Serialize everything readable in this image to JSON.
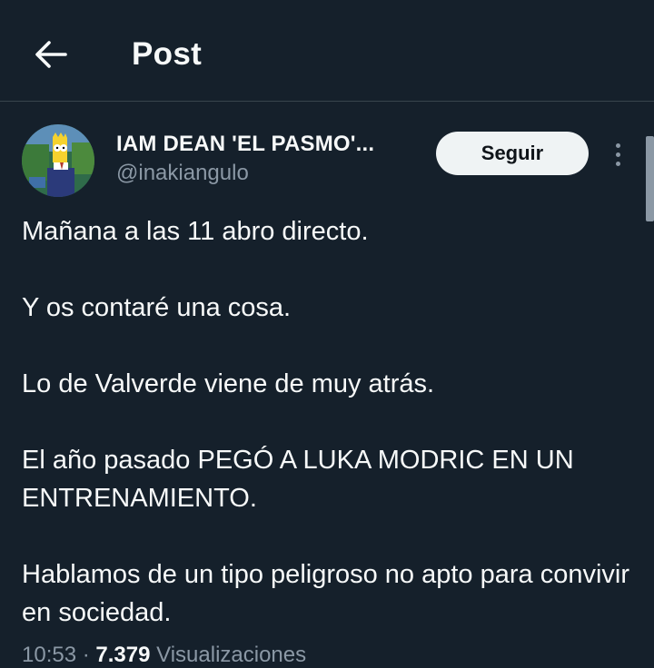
{
  "header": {
    "title": "Post"
  },
  "author": {
    "display_name": "IAM DEAN 'EL PASMO'...",
    "handle": "@inakiangulo"
  },
  "follow_button": {
    "label": "Seguir"
  },
  "tweet": {
    "paragraphs": [
      "Mañana a las 11 abro directo.",
      "Y os contaré una cosa.",
      "Lo de Valverde viene de muy atrás.",
      "El año pasado PEGÓ A LUKA MODRIC EN UN ENTRENAMIENTO.",
      "Hablamos de un tipo peligroso no apto para convivir en sociedad."
    ]
  },
  "meta": {
    "time": "10:53",
    "views_count": "7.379",
    "views_label": "Visualizaciones"
  },
  "colors": {
    "background": "#15202b",
    "text": "#f7f9f9",
    "secondary": "#8b98a5",
    "divider": "#38444d",
    "button_bg": "#eff3f4"
  }
}
